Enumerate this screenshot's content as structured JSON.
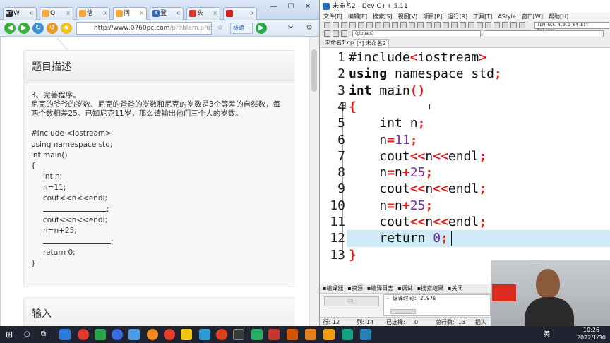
{
  "browser": {
    "tabs": [
      {
        "fav": "BT",
        "label": "W",
        "color": "#2a2a2a"
      },
      {
        "fav": "",
        "label": "O",
        "color": "#f2a83a"
      },
      {
        "fav": "",
        "label": "信",
        "color": "#f2a83a"
      },
      {
        "fav": "",
        "label": "问",
        "color": "#f2a83a"
      },
      {
        "fav": "K",
        "label": "登",
        "color": "#2f6fc9"
      },
      {
        "fav": "",
        "label": "头",
        "color": "#d63a2a"
      },
      {
        "fav": "",
        "label": "",
        "color": "#d62020"
      }
    ],
    "url_host": "http://www.0760pc.com",
    "url_path": "/problem.php",
    "speed_label": "极速",
    "section_title": "题目描述",
    "problem": [
      "3、完善程序。",
      "尼克的爷爷的岁数、尼克的爸爸的岁数和尼克的岁数是3个等差的自然数，每",
      "两个数相差25。已知尼克11岁，那么请输出他们三个人的岁数。",
      "",
      "#include <iostream>",
      "using namespace std;",
      "int main()",
      "{",
      "int  n;",
      "n=11;",
      "cout<<n<<endl;",
      "BLANK_;",
      "cout<<n<<endl;",
      "n=n+25;",
      "BLANK_;",
      "return 0;",
      "}"
    ],
    "section_input": "输入"
  },
  "ide": {
    "title": "未命名2 - Dev-C++ 5.11",
    "menu": [
      "文件[F]",
      "编辑[E]",
      "搜索[S]",
      "视图[V]",
      "项目[P]",
      "运行[R]",
      "工具[T]",
      "AStyle",
      "窗口[W]",
      "帮助[H]"
    ],
    "compiler": "TDM-GCC 4.9.2 64-bit Release",
    "globals": "(globals)",
    "file_tabs": [
      "未命名1.cpp",
      "[*] 未命名2"
    ],
    "code_lines": [
      {
        "n": "1",
        "html": "#include<iostream>"
      },
      {
        "n": "2",
        "html": "using namespace std;"
      },
      {
        "n": "3",
        "html": "int main()"
      },
      {
        "n": "4",
        "html": "{"
      },
      {
        "n": "5",
        "html": "    int n;"
      },
      {
        "n": "6",
        "html": "    n=11;"
      },
      {
        "n": "7",
        "html": "    cout<<n<<endl;"
      },
      {
        "n": "8",
        "html": "    n=n+25;"
      },
      {
        "n": "9",
        "html": "    cout<<n<<endl;"
      },
      {
        "n": "10",
        "html": "    n=n+25;"
      },
      {
        "n": "11",
        "html": "    cout<<n<<endl;"
      },
      {
        "n": "12",
        "html": "    return 0;"
      },
      {
        "n": "13",
        "html": "}"
      }
    ],
    "bottom_tabs": [
      "编译器",
      "资源",
      "编译日志",
      "调试",
      "搜索结果",
      "关闭"
    ],
    "abort_label": "中止",
    "log_line": "- 编译时间: 2.97s",
    "status": {
      "row_label": "行:",
      "row": "12",
      "col_label": "列:",
      "col": "14",
      "sel_label": "已选择:",
      "sel": "0",
      "total_label": "总行数:",
      "total": "13",
      "mode": "插入"
    }
  },
  "taskbar": {
    "time": "10:26",
    "date": "2022/1/30",
    "lang": "英"
  }
}
